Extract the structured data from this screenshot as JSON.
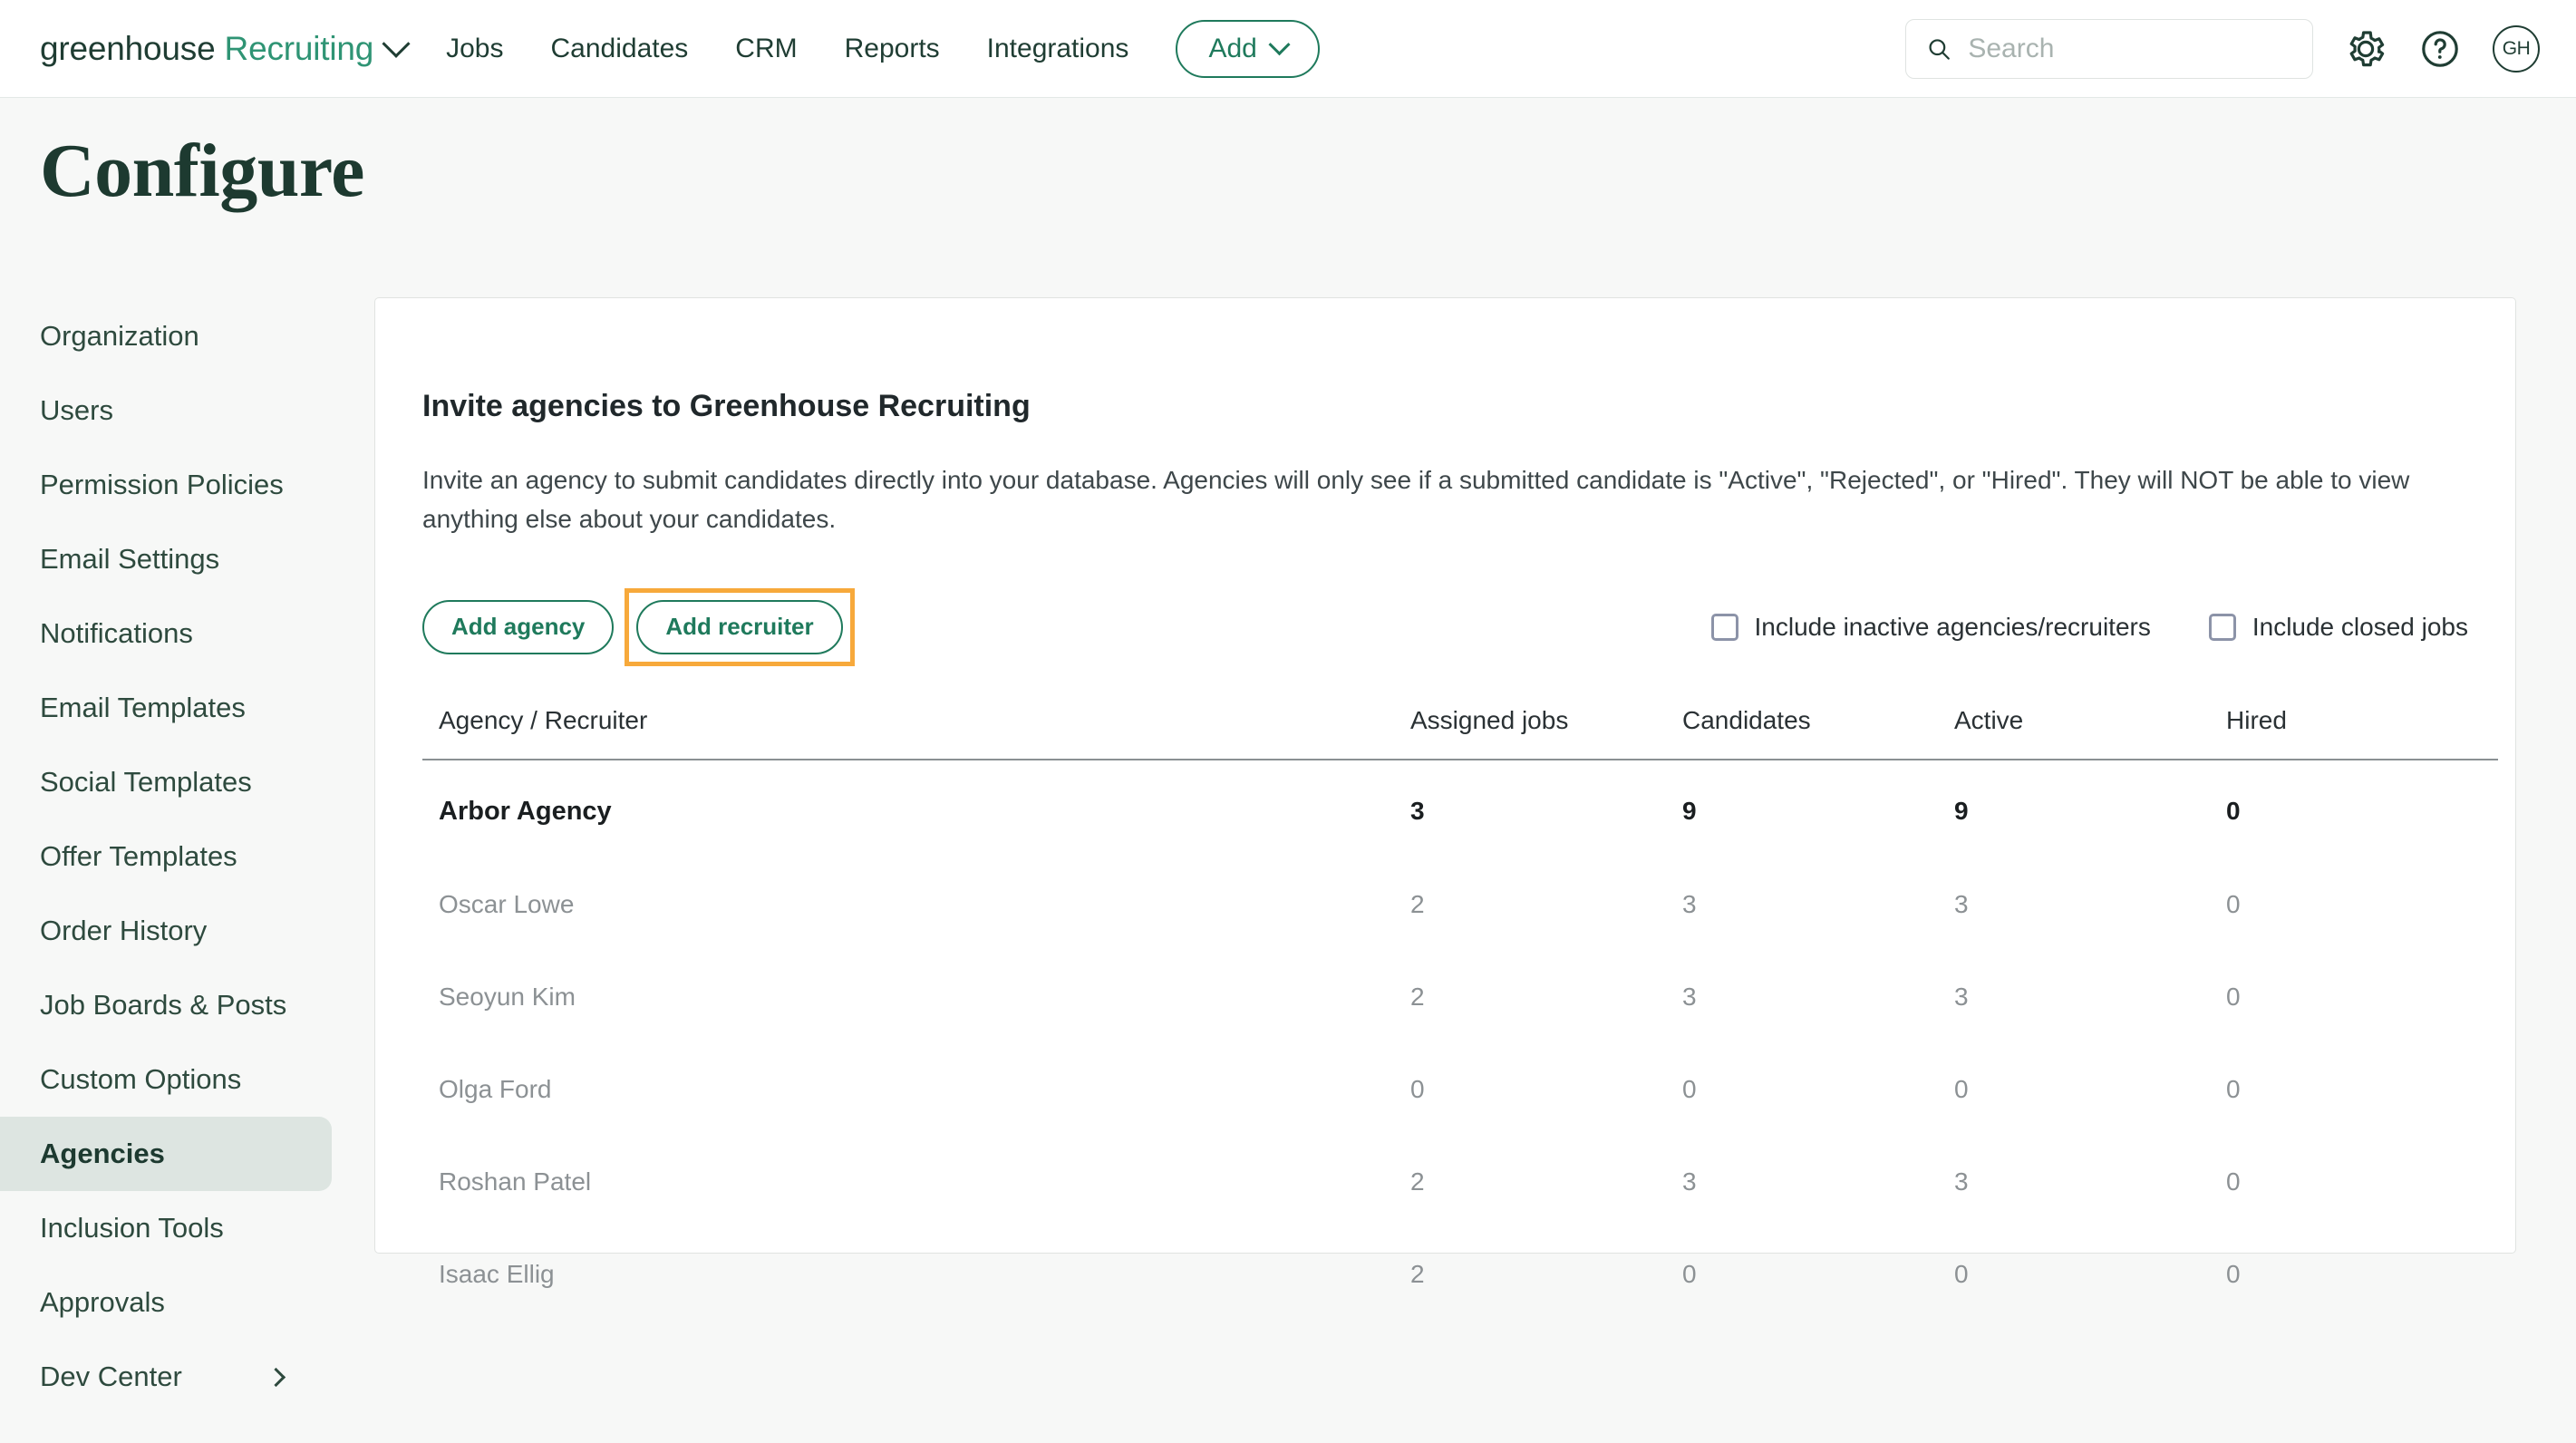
{
  "topnav": {
    "brand_primary": "greenhouse",
    "brand_secondary": "Recruiting",
    "links": [
      "Jobs",
      "Candidates",
      "CRM",
      "Reports",
      "Integrations"
    ],
    "add_button": "Add",
    "search_placeholder": "Search",
    "search_value": "",
    "avatar_initials": "GH"
  },
  "page": {
    "title": "Configure"
  },
  "sidebar": {
    "items": [
      {
        "label": "Organization",
        "active": false,
        "has_chevron": false
      },
      {
        "label": "Users",
        "active": false,
        "has_chevron": false
      },
      {
        "label": "Permission Policies",
        "active": false,
        "has_chevron": false
      },
      {
        "label": "Email Settings",
        "active": false,
        "has_chevron": false
      },
      {
        "label": "Notifications",
        "active": false,
        "has_chevron": false
      },
      {
        "label": "Email Templates",
        "active": false,
        "has_chevron": false
      },
      {
        "label": "Social Templates",
        "active": false,
        "has_chevron": false
      },
      {
        "label": "Offer Templates",
        "active": false,
        "has_chevron": false
      },
      {
        "label": "Order History",
        "active": false,
        "has_chevron": false
      },
      {
        "label": "Job Boards & Posts",
        "active": false,
        "has_chevron": false
      },
      {
        "label": "Custom Options",
        "active": false,
        "has_chevron": false
      },
      {
        "label": "Agencies",
        "active": true,
        "has_chevron": false
      },
      {
        "label": "Inclusion Tools",
        "active": false,
        "has_chevron": false
      },
      {
        "label": "Approvals",
        "active": false,
        "has_chevron": false
      },
      {
        "label": "Dev Center",
        "active": false,
        "has_chevron": true
      }
    ]
  },
  "main": {
    "title": "Invite agencies to Greenhouse Recruiting",
    "description": "Invite an agency to submit candidates directly into your database. Agencies will only see if a submitted candidate is \"Active\", \"Rejected\", or \"Hired\". They will NOT be able to view anything else about your candidates.",
    "add_agency_label": "Add agency",
    "add_recruiter_label": "Add recruiter",
    "checkbox_inactive_label": "Include inactive agencies/recruiters",
    "checkbox_inactive_checked": false,
    "checkbox_closed_label": "Include closed jobs",
    "checkbox_closed_checked": false,
    "highlight_color": "#f7a93b",
    "accent_color": "#1f7a5c",
    "link_color": "#118060",
    "table": {
      "headers": [
        "Agency / Recruiter",
        "Assigned jobs",
        "Candidates",
        "Active",
        "Hired"
      ],
      "rows": [
        {
          "type": "agency",
          "name": "Arbor Agency",
          "assigned_jobs": "3",
          "candidates": "9",
          "active": "9",
          "hired": "0"
        },
        {
          "type": "recruiter",
          "name": "Oscar Lowe",
          "assigned_jobs": "2",
          "candidates": "3",
          "active": "3",
          "hired": "0"
        },
        {
          "type": "recruiter",
          "name": "Seoyun Kim",
          "assigned_jobs": "2",
          "candidates": "3",
          "active": "3",
          "hired": "0"
        },
        {
          "type": "recruiter",
          "name": "Olga Ford",
          "assigned_jobs": "0",
          "candidates": "0",
          "active": "0",
          "hired": "0"
        },
        {
          "type": "recruiter",
          "name": "Roshan Patel",
          "assigned_jobs": "2",
          "candidates": "3",
          "active": "3",
          "hired": "0"
        },
        {
          "type": "recruiter",
          "name": "Isaac Ellig",
          "assigned_jobs": "2",
          "candidates": "0",
          "active": "0",
          "hired": "0"
        }
      ]
    }
  }
}
